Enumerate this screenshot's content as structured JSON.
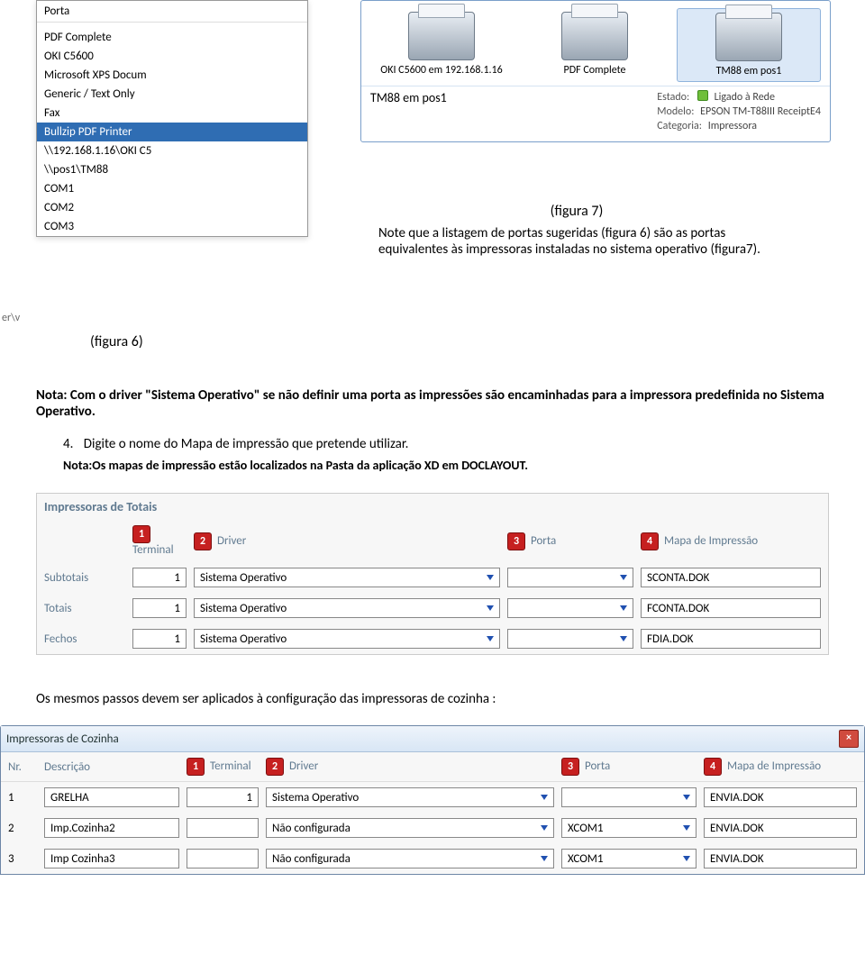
{
  "ports": {
    "header": "Porta",
    "items": [
      {
        "label": "",
        "selected": false
      },
      {
        "label": "PDF Complete",
        "selected": false
      },
      {
        "label": "OKI C5600",
        "selected": false
      },
      {
        "label": "Microsoft XPS Docum",
        "selected": false
      },
      {
        "label": "Generic / Text Only",
        "selected": false
      },
      {
        "label": "Fax",
        "selected": false
      },
      {
        "label": "Bullzip PDF Printer",
        "selected": true
      },
      {
        "label": "\\\\192.168.1.16\\OKI C5",
        "selected": false
      },
      {
        "label": "\\\\pos1\\TM88",
        "selected": false
      },
      {
        "label": "COM1",
        "selected": false
      },
      {
        "label": "COM2",
        "selected": false
      },
      {
        "label": "COM3",
        "selected": false
      }
    ],
    "left_cut_text": "er\\v"
  },
  "printers_panel": {
    "tiles": [
      {
        "name": "OKI C5600 em 192.168.1.16"
      },
      {
        "name": "PDF Complete"
      },
      {
        "name": "TM88 em pos1",
        "selected": true
      }
    ],
    "selected_info": {
      "name": "TM88 em pos1",
      "estado_label": "Estado:",
      "estado_value": "Ligado à Rede",
      "modelo_label": "Modelo:",
      "modelo_value": "EPSON TM-T88III ReceiptE4",
      "categoria_label": "Categoria:",
      "categoria_value": "Impressora"
    }
  },
  "text": {
    "fig7": "(figura 7)",
    "para1": "Note que a listagem de portas sugeridas (figura 6) são as portas equivalentes às impressoras instaladas no sistema operativo (figura7).",
    "fig6": "(figura 6)",
    "nota": "Nota: Com o driver \"Sistema Operativo\" se não definir uma porta as impressões são encaminhadas para a impressora predefinida no Sistema Operativo.",
    "step4_num": "4.",
    "step4": "Digite o nome do Mapa de impressão que pretende utilizar.",
    "step4_sub": "Nota:Os mapas de impressão estão localizados na Pasta da aplicação XD em DOCLAYOUT.",
    "mid": "Os mesmos passos devem ser aplicados à configuração das impressoras de cozinha :"
  },
  "totals": {
    "title": "Impressoras de Totais",
    "headers": {
      "terminal": "Terminal",
      "driver": "Driver",
      "porta": "Porta",
      "mapa": "Mapa de Impressão",
      "b1": "1",
      "b2": "2",
      "b3": "3",
      "b4": "4"
    },
    "rows": [
      {
        "label": "Subtotais",
        "terminal": "1",
        "driver": "Sistema Operativo",
        "porta": "",
        "mapa": "SCONTA.DOK"
      },
      {
        "label": "Totais",
        "terminal": "1",
        "driver": "Sistema Operativo",
        "porta": "",
        "mapa": "FCONTA.DOK"
      },
      {
        "label": "Fechos",
        "terminal": "1",
        "driver": "Sistema Operativo",
        "porta": "",
        "mapa": "FDIA.DOK"
      }
    ]
  },
  "cozinha": {
    "title": "Impressoras de Cozinha",
    "headers": {
      "nr": "Nr.",
      "desc": "Descrição",
      "terminal": "Terminal",
      "driver": "Driver",
      "porta": "Porta",
      "mapa": "Mapa de Impressão",
      "b1": "1",
      "b2": "2",
      "b3": "3",
      "b4": "4"
    },
    "rows": [
      {
        "nr": "1",
        "desc": "GRELHA",
        "terminal": "1",
        "driver": "Sistema Operativo",
        "porta": "",
        "mapa": "ENVIA.DOK"
      },
      {
        "nr": "2",
        "desc": "Imp.Cozinha2",
        "terminal": "",
        "driver": "Não configurada",
        "porta": "XCOM1",
        "mapa": "ENVIA.DOK"
      },
      {
        "nr": "3",
        "desc": "Imp Cozinha3",
        "terminal": "",
        "driver": "Não configurada",
        "porta": "XCOM1",
        "mapa": "ENVIA.DOK"
      }
    ]
  }
}
